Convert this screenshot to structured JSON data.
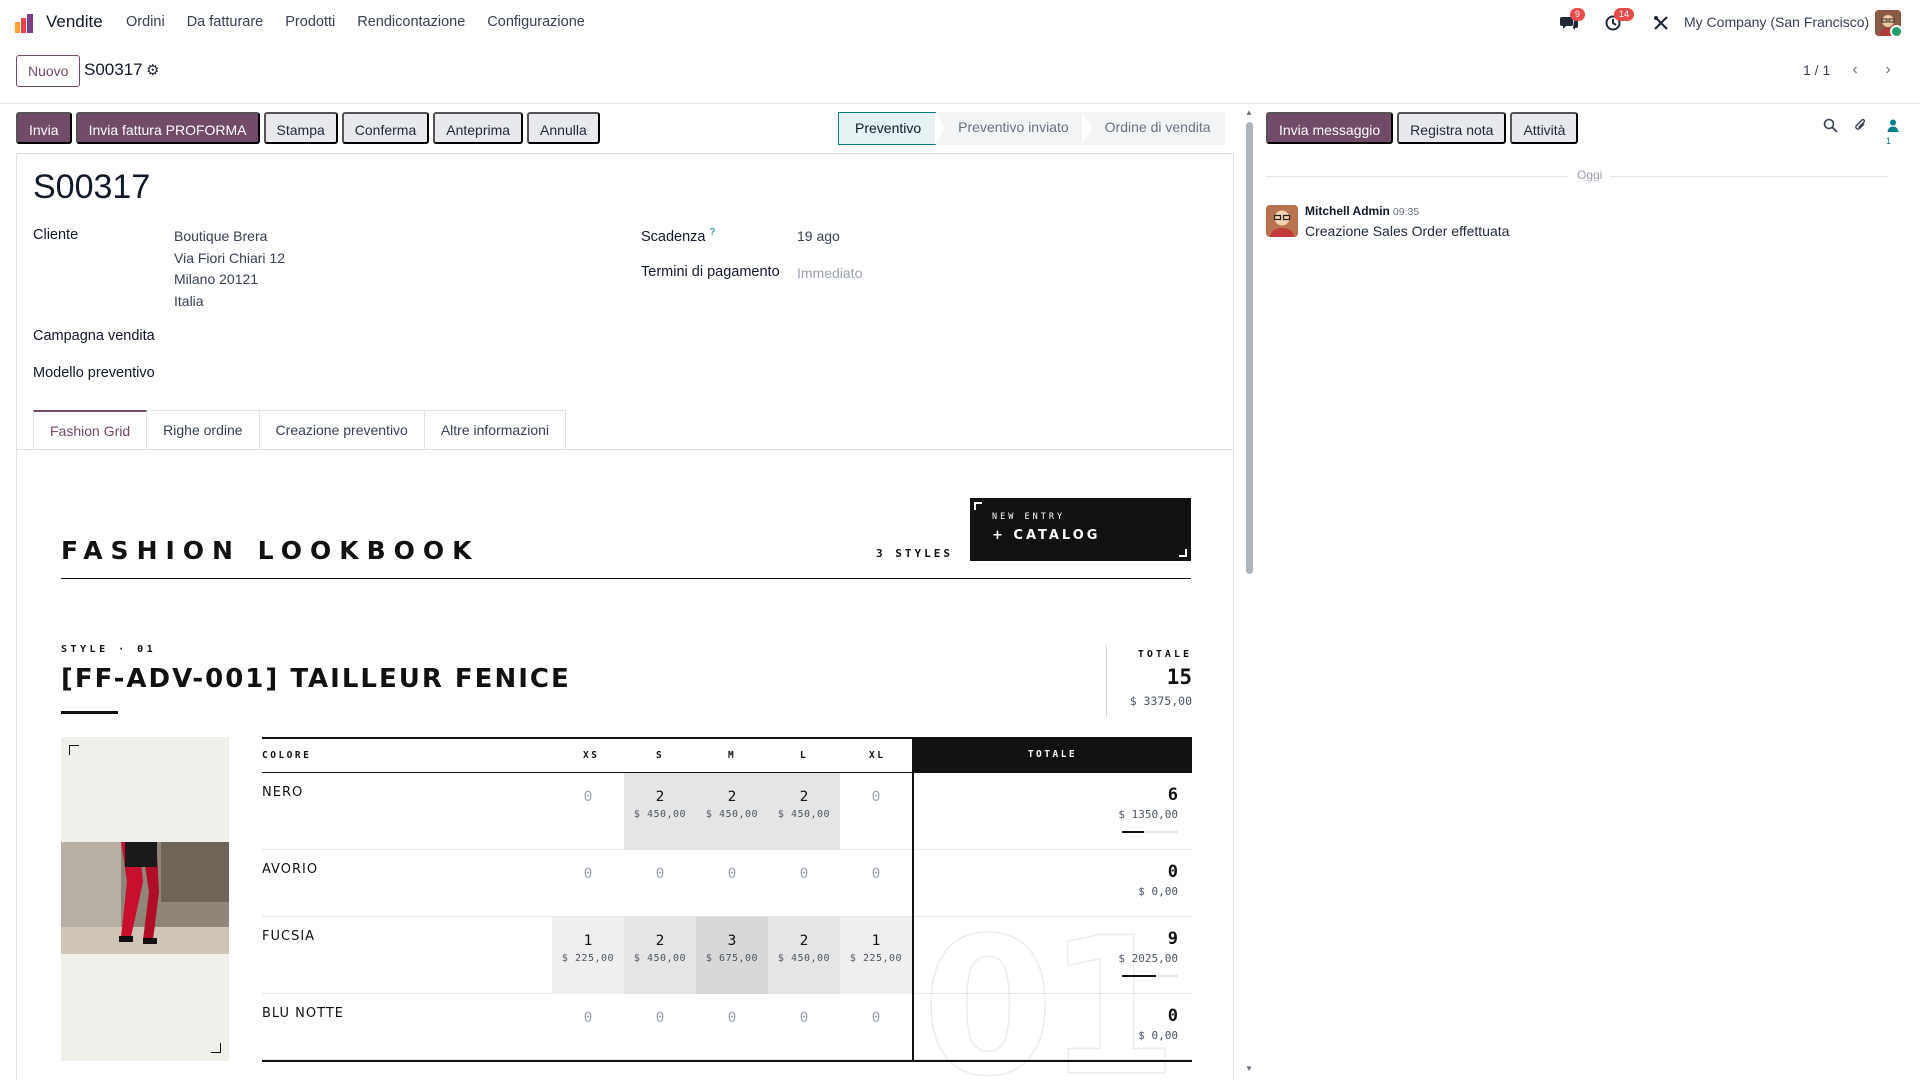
{
  "navbar": {
    "app_name": "Vendite",
    "menu": [
      "Ordini",
      "Da fatturare",
      "Prodotti",
      "Rendicontazione",
      "Configurazione"
    ],
    "messages_badge": "9",
    "activities_badge": "14",
    "company": "My Company (San Francisco)"
  },
  "control": {
    "new_label": "Nuovo",
    "record": "S00317",
    "pager": "1 / 1"
  },
  "actions": [
    "Invia",
    "Invia fattura PROFORMA",
    "Stampa",
    "Conferma",
    "Anteprima",
    "Annulla"
  ],
  "statusbar": {
    "stages": [
      "Preventivo",
      "Preventivo inviato",
      "Ordine di vendita"
    ],
    "active": "Preventivo"
  },
  "form": {
    "title": "S00317",
    "customer_label": "Cliente",
    "customer_lines": [
      "Boutique Brera",
      "Via Fiori Chiari 12",
      "Milano 20121",
      "Italia"
    ],
    "expiry_label": "Scadenza",
    "expiry_help": "?",
    "expiry_value": "19 ago",
    "payment_terms_label": "Termini di pagamento",
    "payment_terms_value": "Immediato",
    "campaign_label": "Campagna vendita",
    "template_label": "Modello preventivo",
    "tabs": [
      "Fashion Grid",
      "Righe ordine",
      "Creazione preventivo",
      "Altre informazioni"
    ]
  },
  "lookbook": {
    "title": "FASHION LOOKBOOK",
    "styles_count": "3 STYLES",
    "catalog_small": "NEW ENTRY",
    "catalog_big": "+ CATALOG",
    "style": {
      "label": "STYLE · 01",
      "name": "[FF-ADV-001] TAILLEUR FENICE",
      "total_label": "TOTALE",
      "total_qty": "15",
      "total_amount": "$ 3375,00",
      "big_number": "01",
      "columns": [
        "COLORE",
        "XS",
        "S",
        "M",
        "L",
        "XL"
      ],
      "total_col": "TOTALE",
      "rows": [
        {
          "color": "NERO",
          "cells": [
            {
              "q": "0",
              "p": ""
            },
            {
              "q": "2",
              "p": "$ 450,00"
            },
            {
              "q": "2",
              "p": "$ 450,00"
            },
            {
              "q": "2",
              "p": "$ 450,00"
            },
            {
              "q": "0",
              "p": ""
            }
          ],
          "total_q": "6",
          "total_p": "$ 1350,00",
          "share": 0.4
        },
        {
          "color": "AVORIO",
          "cells": [
            {
              "q": "0",
              "p": ""
            },
            {
              "q": "0",
              "p": ""
            },
            {
              "q": "0",
              "p": ""
            },
            {
              "q": "0",
              "p": ""
            },
            {
              "q": "0",
              "p": ""
            }
          ],
          "total_q": "0",
          "total_p": "$ 0,00",
          "share": 0
        },
        {
          "color": "FUCSIA",
          "cells": [
            {
              "q": "1",
              "p": "$ 225,00"
            },
            {
              "q": "2",
              "p": "$ 450,00"
            },
            {
              "q": "3",
              "p": "$ 675,00"
            },
            {
              "q": "2",
              "p": "$ 450,00"
            },
            {
              "q": "1",
              "p": "$ 225,00"
            }
          ],
          "total_q": "9",
          "total_p": "$ 2025,00",
          "share": 0.6
        },
        {
          "color": "BLU NOTTE",
          "cells": [
            {
              "q": "0",
              "p": ""
            },
            {
              "q": "0",
              "p": ""
            },
            {
              "q": "0",
              "p": ""
            },
            {
              "q": "0",
              "p": ""
            },
            {
              "q": "0",
              "p": ""
            }
          ],
          "total_q": "0",
          "total_p": "$ 0,00",
          "share": 0
        }
      ]
    }
  },
  "chatter": {
    "buttons": [
      "Invia messaggio",
      "Registra nota",
      "Attività"
    ],
    "followers_count": "1",
    "date_separator": "Oggi",
    "message": {
      "author": "Mitchell Admin",
      "time": "09:35",
      "body": "Creazione Sales Order effettuata"
    }
  },
  "colors": {
    "brand": "#714b67",
    "status_active": "#017e84",
    "badge": "#e54b4b"
  }
}
